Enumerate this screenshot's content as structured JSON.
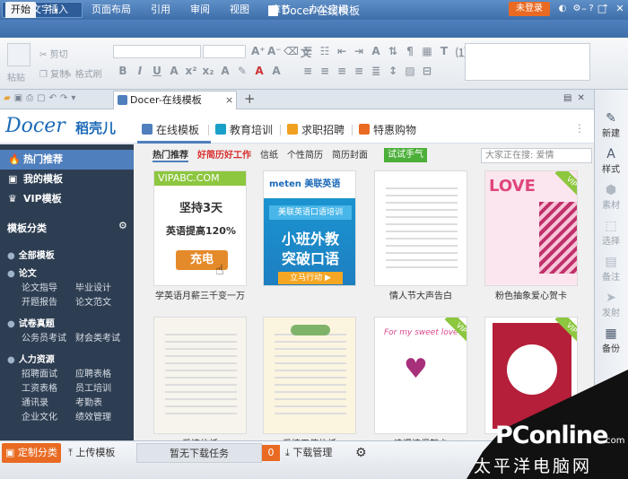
{
  "app": {
    "button_label": "WPS 文字",
    "window_title": "Docer-在线模板"
  },
  "window_controls": {
    "minimize": "–",
    "maximize": "□",
    "close": "✕"
  },
  "menu_tabs": [
    "开始",
    "插入",
    "页面布局",
    "引用",
    "审阅",
    "视图",
    "章节",
    "办公空间"
  ],
  "login_label": "未登录",
  "ribbon": {
    "paste": "粘贴",
    "cut": "剪切",
    "copy": "复制",
    "format_painter": "格式刷"
  },
  "doc_tab": {
    "title": "Docer-在线模板",
    "close": "×",
    "new": "+"
  },
  "logo": {
    "main": "Docer",
    "sub": "稻壳儿"
  },
  "categories": [
    {
      "label": "在线模板",
      "color": "#4f7fbd"
    },
    {
      "label": "教育培训",
      "color": "#19a0c8"
    },
    {
      "label": "求职招聘",
      "color": "#f0a020"
    },
    {
      "label": "特惠购物",
      "color": "#e96a22"
    }
  ],
  "sidebar": {
    "top_items": [
      {
        "label": "热门推荐",
        "icon": "flame-icon",
        "glyph": "🔥",
        "active": true
      },
      {
        "label": "我的模板",
        "icon": "doc-icon",
        "glyph": "▣",
        "active": false
      },
      {
        "label": "VIP模板",
        "icon": "vip-icon",
        "glyph": "♛",
        "active": false
      }
    ],
    "section_title": "模板分类",
    "groups": [
      {
        "title": "全部模板",
        "subs": []
      },
      {
        "title": "论文",
        "subs": [
          "论文指导",
          "毕业设计",
          "开题报告",
          "论文范文"
        ]
      },
      {
        "title": "试卷真题",
        "subs": [
          "公务员考试",
          "财会类考试"
        ]
      },
      {
        "title": "人力资源",
        "subs": [
          "招聘面试",
          "应聘表格",
          "工资表格",
          "员工培训",
          "通讯录",
          "考勤表",
          "企业文化",
          "绩效管理"
        ]
      }
    ]
  },
  "subtabs": [
    {
      "label": "热门推荐",
      "style": "active"
    },
    {
      "label": "好简历好工作",
      "style": "red"
    },
    {
      "label": "信纸",
      "style": "normal"
    },
    {
      "label": "个性简历",
      "style": "normal"
    },
    {
      "label": "简历封面",
      "style": "normal"
    }
  ],
  "try_button": "试试手气",
  "search_placeholder": "大家正在搜: 爱情",
  "cards": [
    {
      "caption": "学英语月薪三千变一万",
      "ad": {
        "brand": "VIPABC.COM",
        "l1": "坚持3天",
        "l2": "英语提高120%",
        "btn": "充电"
      }
    },
    {
      "caption": "",
      "ad": {
        "brand": "meten 美联英语",
        "banner": "美联英语口语培训",
        "l1": "小班外教",
        "l2": "突破口语",
        "btn": "立马行动 ▶"
      }
    },
    {
      "caption": "情人节大声告白",
      "vip": false
    },
    {
      "caption": "粉色抽象爱心贺卡",
      "vip": true,
      "label": "LOVE"
    },
    {
      "caption": "爱情信纸",
      "vip": false
    },
    {
      "caption": "爱情天使信纸",
      "vip": false
    },
    {
      "caption": "浪漫情侣贺卡",
      "vip": true,
      "label": "For my sweet love"
    },
    {
      "caption": "",
      "vip": true
    }
  ],
  "right_panel": [
    {
      "label": "新建",
      "icon": "new-icon",
      "glyph": "✎",
      "dim": false
    },
    {
      "label": "样式",
      "icon": "style-icon",
      "glyph": "A",
      "dim": false
    },
    {
      "label": "素材",
      "icon": "material-icon",
      "glyph": "⬢",
      "dim": true
    },
    {
      "label": "选择",
      "icon": "select-icon",
      "glyph": "⬚",
      "dim": true
    },
    {
      "label": "备注",
      "icon": "note-icon",
      "glyph": "▤",
      "dim": true
    },
    {
      "label": "发射",
      "icon": "send-icon",
      "glyph": "➤",
      "dim": true
    },
    {
      "label": "备份",
      "icon": "backup-icon",
      "glyph": "▦",
      "dim": false
    }
  ],
  "bottom": {
    "custom": "定制分类",
    "upload": "上传模板",
    "no_download": "暂无下载任务",
    "count": "0",
    "download_mgr": "下载管理"
  },
  "watermark": {
    "brand": "PConline",
    "domain": ".com",
    "cn": "太平洋电脑网"
  }
}
